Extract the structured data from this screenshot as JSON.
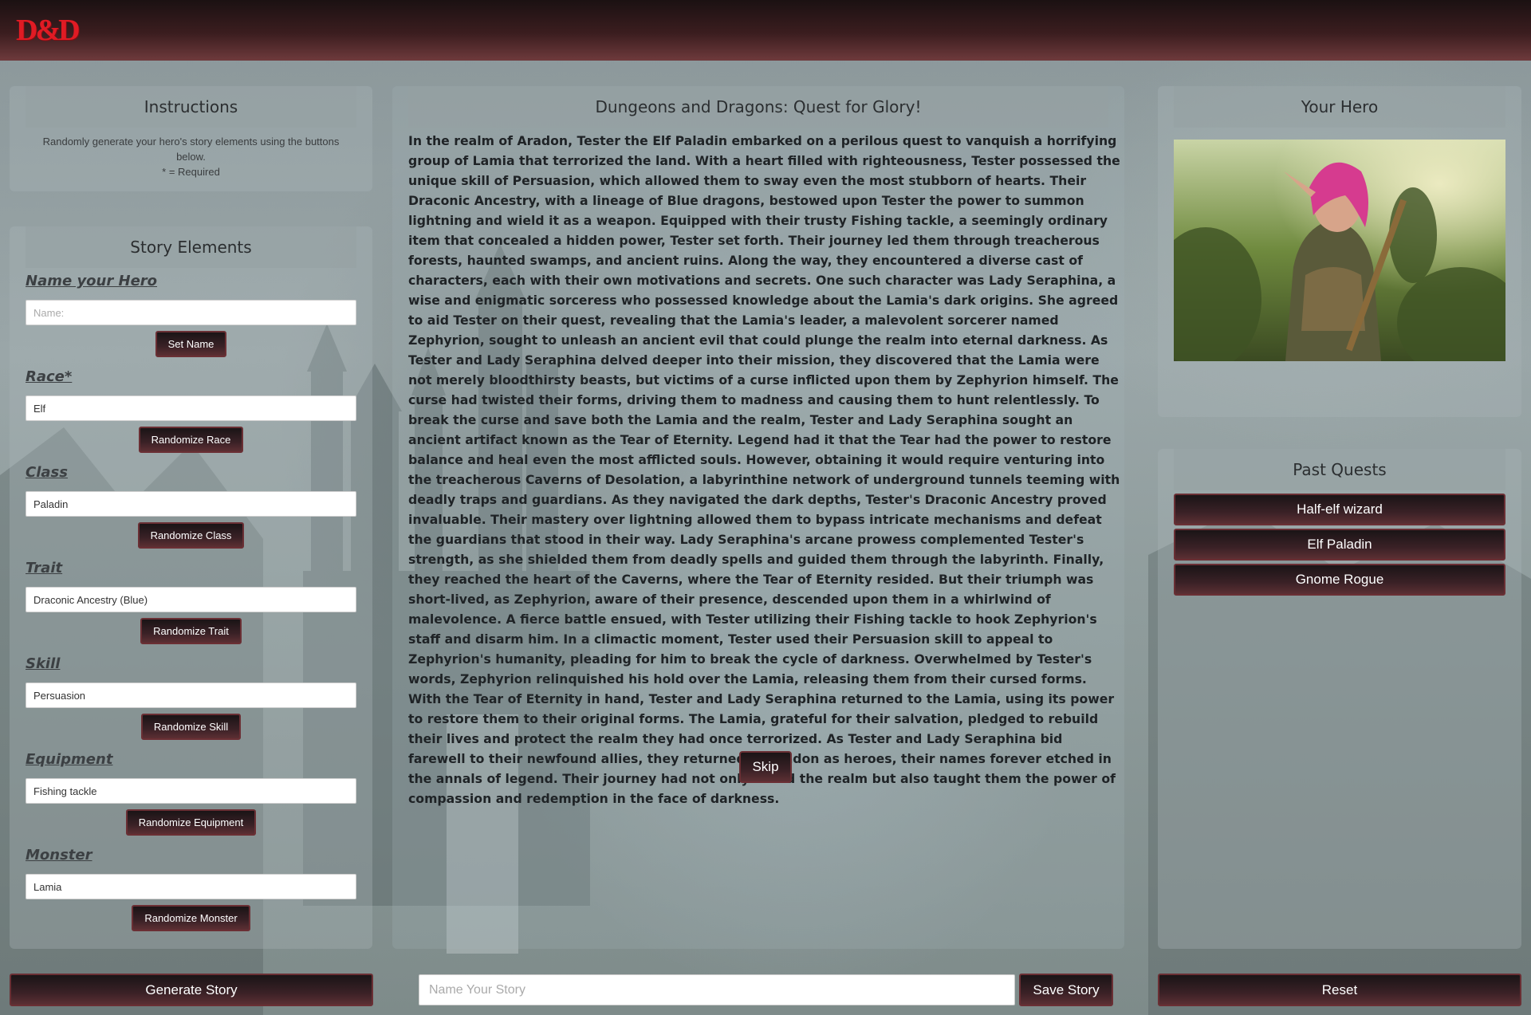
{
  "app": {
    "logo_text": "D&D"
  },
  "instructions": {
    "title": "Instructions",
    "text": "Randomly generate your hero's story elements using the buttons below.",
    "required_note": "* = Required"
  },
  "story_elements": {
    "title": "Story Elements",
    "name": {
      "label": "Name your Hero",
      "placeholder": "Name:",
      "value": "",
      "button": "Set Name"
    },
    "race": {
      "label": "Race*",
      "value": "Elf",
      "button": "Randomize Race"
    },
    "class": {
      "label": "Class",
      "value": "Paladin",
      "button": "Randomize Class"
    },
    "trait": {
      "label": "Trait",
      "value": "Draconic Ancestry (Blue)",
      "button": "Randomize Trait"
    },
    "skill": {
      "label": "Skill",
      "value": "Persuasion",
      "button": "Randomize Skill"
    },
    "equipment": {
      "label": "Equipment",
      "value": "Fishing tackle",
      "button": "Randomize Equipment"
    },
    "monster": {
      "label": "Monster",
      "value": "Lamia",
      "button": "Randomize Monster"
    }
  },
  "story": {
    "title": "Dungeons and Dragons: Quest for Glory!",
    "text": "In the realm of Aradon, Tester the Elf Paladin embarked on a perilous quest to vanquish a horrifying group of Lamia that terrorized the land. With a heart filled with righteousness, Tester possessed the unique skill of Persuasion, which allowed them to sway even the most stubborn of hearts. Their Draconic Ancestry, with a lineage of Blue dragons, bestowed upon Tester the power to summon lightning and wield it as a weapon. Equipped with their trusty Fishing tackle, a seemingly ordinary item that concealed a hidden power, Tester set forth. Their journey led them through treacherous forests, haunted swamps, and ancient ruins. Along the way, they encountered a diverse cast of characters, each with their own motivations and secrets. One such character was Lady Seraphina, a wise and enigmatic sorceress who possessed knowledge about the Lamia's dark origins. She agreed to aid Tester on their quest, revealing that the Lamia's leader, a malevolent sorcerer named Zephyrion, sought to unleash an ancient evil that could plunge the realm into eternal darkness. As Tester and Lady Seraphina delved deeper into their mission, they discovered that the Lamia were not merely bloodthirsty beasts, but victims of a curse inflicted upon them by Zephyrion himself. The curse had twisted their forms, driving them to madness and causing them to hunt relentlessly. To break the curse and save both the Lamia and the realm, Tester and Lady Seraphina sought an ancient artifact known as the Tear of Eternity. Legend had it that the Tear had the power to restore balance and heal even the most afflicted souls. However, obtaining it would require venturing into the treacherous Caverns of Desolation, a labyrinthine network of underground tunnels teeming with deadly traps and guardians. As they navigated the dark depths, Tester's Draconic Ancestry proved invaluable. Their mastery over lightning allowed them to bypass intricate mechanisms and defeat the guardians that stood in their way. Lady Seraphina's arcane prowess complemented Tester's strength, as she shielded them from deadly spells and guided them through the labyrinth. Finally, they reached the heart of the Caverns, where the Tear of Eternity resided. But their triumph was short-lived, as Zephyrion, aware of their presence, descended upon them in a whirlwind of malevolence. A fierce battle ensued, with Tester utilizing their Fishing tackle to hook Zephyrion's staff and disarm him. In a climactic moment, Tester used their Persuasion skill to appeal to Zephyrion's humanity, pleading for him to break the cycle of darkness. Overwhelmed by Tester's words, Zephyrion relinquished his hold over the Lamia, releasing them from their cursed forms. With the Tear of Eternity in hand, Tester and Lady Seraphina returned to the Lamia, using its power to restore them to their original forms. The Lamia, grateful for their salvation, pledged to rebuild their lives and protect the realm they had once terrorized. As Tester and Lady Seraphina bid farewell to their newfound allies, they returned to Aradon as heroes, their names forever etched in the annals of legend. Their journey had not only saved the realm but also taught them the power of compassion and redemption in the face of darkness.",
    "skip_button": "Skip"
  },
  "hero": {
    "title": "Your Hero"
  },
  "past_quests": {
    "title": "Past Quests",
    "items": [
      "Half-elf wizard",
      "Elf Paladin",
      "Gnome Rogue"
    ]
  },
  "bottom": {
    "generate_button": "Generate Story",
    "story_name_placeholder": "Name Your Story",
    "save_button": "Save Story",
    "reset_button": "Reset"
  },
  "colors": {
    "accent_dark": "#3a2126",
    "accent_border": "#6a2f34",
    "logo_red": "#e01b24"
  }
}
